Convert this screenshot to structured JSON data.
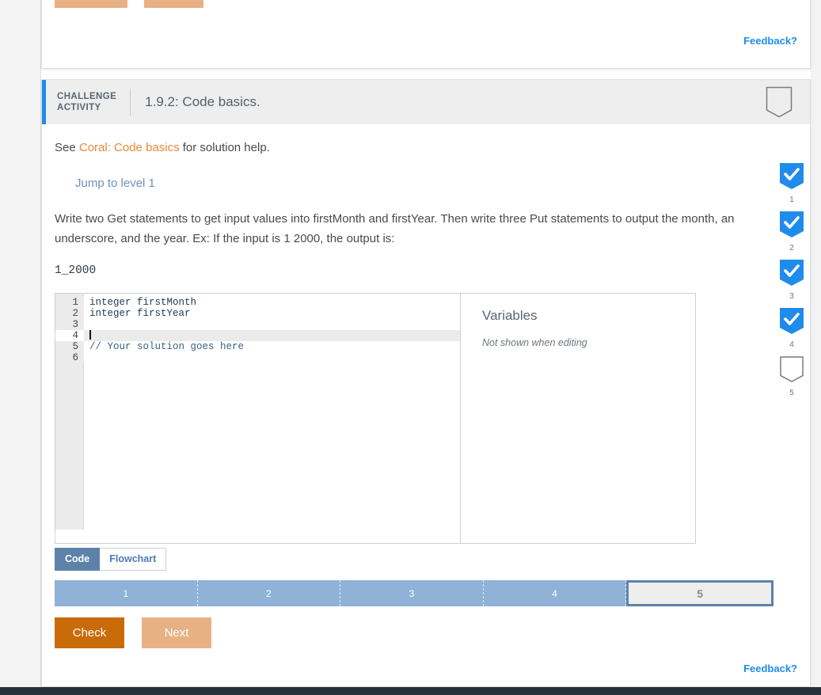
{
  "colors": {
    "accent_blue": "#1f8ceb",
    "link_orange": "#e8883a",
    "check_button": "#ca6b09",
    "next_button": "#e8b183",
    "progress_fill": "#8fb2d6",
    "tab_active": "#5d82a9",
    "badge_blue": "#1f8ceb"
  },
  "top_card": {
    "feedback_label": "Feedback?"
  },
  "challenge": {
    "kicker": "CHALLENGE\nACTIVITY",
    "title": "1.9.2: Code basics.",
    "header_badge_icon": "shield-outline-icon",
    "see_prefix": "See ",
    "see_link": "Coral: Code basics",
    "see_suffix": " for solution help.",
    "jump_link": "Jump to level 1",
    "prompt": "Write two Get statements to get input values into firstMonth and firstYear. Then write three Put statements to output the month, an underscore, and the year. Ex: If the input is 1 2000, the output is:",
    "sample_output": "1_2000",
    "feedback_label": "Feedback?"
  },
  "editor": {
    "lines": [
      {
        "number": "1",
        "text": "integer firstMonth",
        "comment": false,
        "active": false,
        "caret": false
      },
      {
        "number": "2",
        "text": "integer firstYear",
        "comment": false,
        "active": false,
        "caret": false
      },
      {
        "number": "3",
        "text": "",
        "comment": false,
        "active": false,
        "caret": false
      },
      {
        "number": "4",
        "text": "",
        "comment": false,
        "active": true,
        "caret": true
      },
      {
        "number": "5",
        "text": "// Your solution goes here",
        "comment": true,
        "active": false,
        "caret": false
      },
      {
        "number": "6",
        "text": "",
        "comment": false,
        "active": false,
        "caret": false
      }
    ],
    "variables_title": "Variables",
    "variables_note": "Not shown when editing"
  },
  "tabs": [
    {
      "label": "Code",
      "active": true
    },
    {
      "label": "Flowchart",
      "active": false
    }
  ],
  "progress": {
    "segments": [
      {
        "label": "1",
        "current": false
      },
      {
        "label": "2",
        "current": false
      },
      {
        "label": "3",
        "current": false
      },
      {
        "label": "4",
        "current": false
      },
      {
        "label": "5",
        "current": true
      }
    ]
  },
  "actions": {
    "check_label": "Check",
    "next_label": "Next"
  },
  "rail": {
    "items": [
      {
        "number": "1",
        "state": "complete",
        "icon": "check-icon"
      },
      {
        "number": "2",
        "state": "complete",
        "icon": "check-icon"
      },
      {
        "number": "3",
        "state": "complete",
        "icon": "check-icon"
      },
      {
        "number": "4",
        "state": "complete",
        "icon": "check-icon"
      },
      {
        "number": "5",
        "state": "incomplete",
        "icon": "shield-outline-icon"
      }
    ]
  }
}
